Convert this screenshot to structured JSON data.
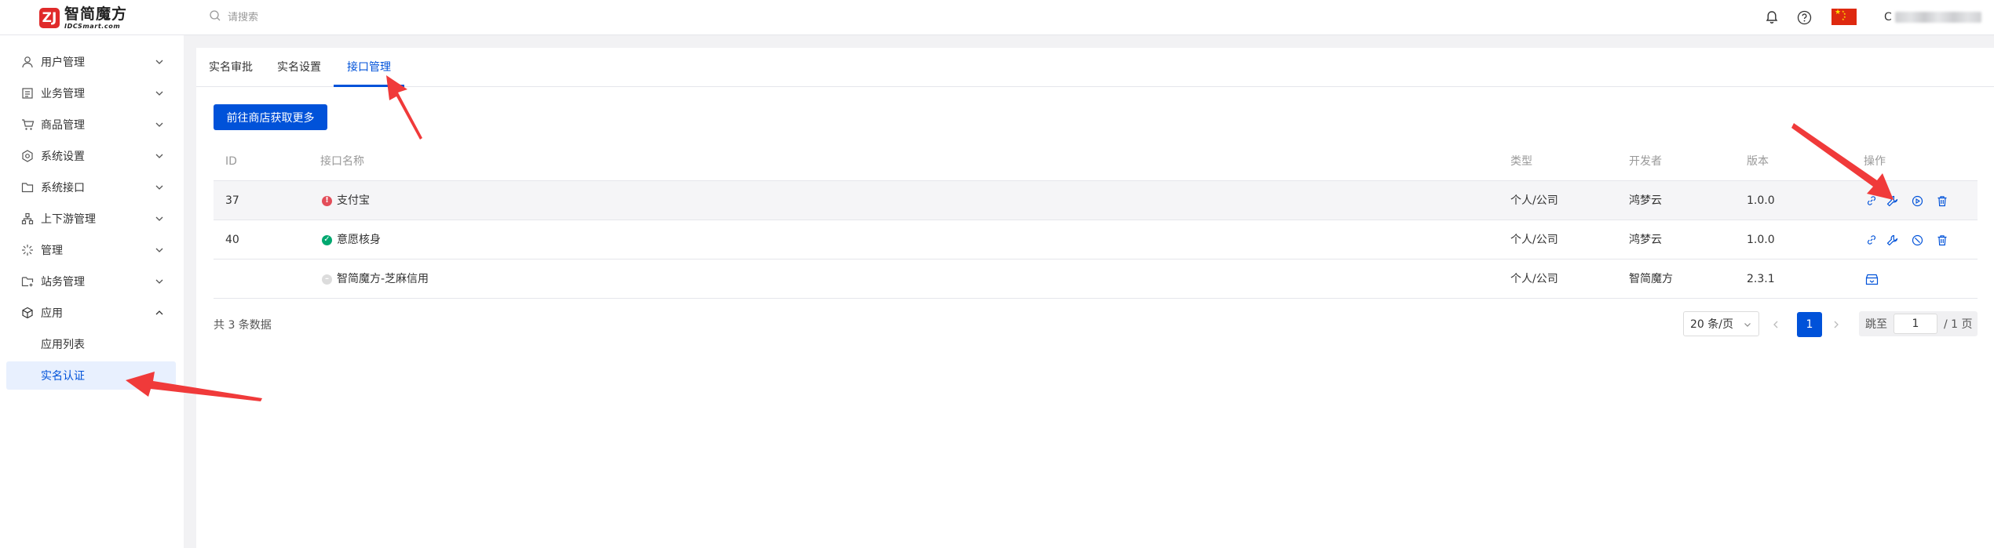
{
  "header": {
    "logo_cn": "智简魔方",
    "logo_en": "IDCSmart.com",
    "search_placeholder": "请搜索",
    "user_initial": "C"
  },
  "sidebar": {
    "items": [
      {
        "label": "用户管理",
        "icon": "user-icon"
      },
      {
        "label": "业务管理",
        "icon": "list-icon"
      },
      {
        "label": "商品管理",
        "icon": "cart-icon"
      },
      {
        "label": "系统设置",
        "icon": "gear-icon"
      },
      {
        "label": "系统接口",
        "icon": "folder-icon"
      },
      {
        "label": "上下游管理",
        "icon": "hierarchy-icon"
      },
      {
        "label": "管理",
        "icon": "loading-icon"
      },
      {
        "label": "站务管理",
        "icon": "folder-add-icon"
      },
      {
        "label": "应用",
        "icon": "cube-icon"
      }
    ],
    "subitems": [
      {
        "label": "应用列表",
        "active": false
      },
      {
        "label": "实名认证",
        "active": true
      }
    ]
  },
  "tabs": [
    {
      "label": "实名审批",
      "active": false
    },
    {
      "label": "实名设置",
      "active": false
    },
    {
      "label": "接口管理",
      "active": true
    }
  ],
  "toolbar": {
    "store_button": "前往商店获取更多"
  },
  "table": {
    "columns": {
      "id": "ID",
      "name": "接口名称",
      "type": "类型",
      "developer": "开发者",
      "version": "版本",
      "actions": "操作"
    },
    "rows": [
      {
        "id": "37",
        "name": "支付宝",
        "status": "error",
        "type": "个人/公司",
        "developer": "鸿梦云",
        "version": "1.0.0"
      },
      {
        "id": "40",
        "name": "意愿核身",
        "status": "enabled",
        "type": "个人/公司",
        "developer": "鸿梦云",
        "version": "1.0.0"
      },
      {
        "id": "",
        "name": "智简魔方-芝麻信用",
        "status": "not-installed",
        "type": "个人/公司",
        "developer": "智简魔方",
        "version": "2.3.1"
      }
    ]
  },
  "pagination": {
    "total_text": "共 3 条数据",
    "page_size": "20 条/页",
    "current_page": "1",
    "jump_label": "跳至",
    "jump_value": "1",
    "total_pages_text": "/ 1 页"
  },
  "colors": {
    "primary": "#0052d9",
    "error": "#e34d59",
    "success": "#00a870",
    "annotation_arrow": "#f03a3a"
  }
}
